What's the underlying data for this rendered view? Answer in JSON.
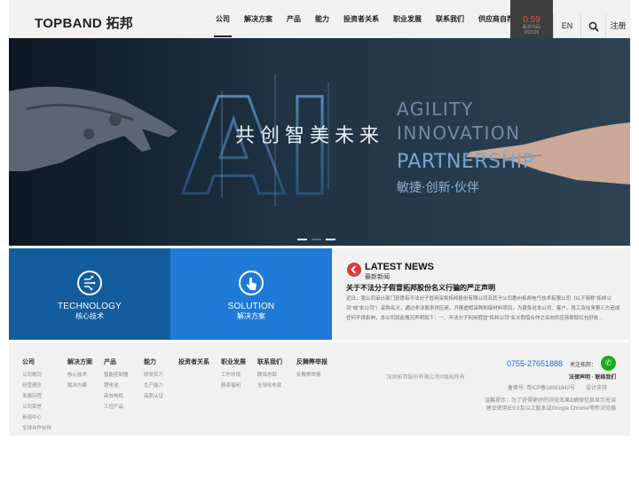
{
  "header": {
    "logo": "TOPBAND 拓邦",
    "nav": [
      "公司",
      "解决方案",
      "产品",
      "能力",
      "投资者关系",
      "职业发展",
      "联系我们",
      "供应商自荐"
    ],
    "stock_value": "0.59",
    "stock_label_1": "股票代码",
    "stock_label_2": "002139",
    "lang_label": "EN",
    "register_label": "注册"
  },
  "banner": {
    "cn_slogan": "共创智美未来",
    "en_line_1": "AGILITY",
    "en_line_2": "INNOVATION",
    "en_line_3": "PARTNERSHIP",
    "cn_tagline": "敏捷·创新·伙伴",
    "big_letters": "AI"
  },
  "tiles": [
    {
      "en": "TECHNOLOGY",
      "cn": "核心技术"
    },
    {
      "en": "SOLUTION",
      "cn": "解决方案"
    }
  ],
  "news": {
    "title": "LATEST NEWS",
    "subtitle": "最新新闻",
    "headline": "关于不法分子假冒拓邦股份名义行骗的严正声明",
    "body": "近日，我公司审计部门获悉有不法分子冒用深圳拓邦股份有限公司及其子公司惠州拓邦电气技术有限公司（以下简称\"拓邦公司\"或\"本公司\"）采购名义，通过非法联系供应商，开展虚假采购和接材料项目，为避免对本公司、客户、员工及往来第三方造成任何不良影响，本公司就此情况声明如下：一、不法分子利用假冒\"拓邦公司\"名义假借合作之名向供应商索取红包好处..."
  },
  "footer": {
    "columns": [
      {
        "head": "公司",
        "items": [
          "公司概况",
          "经营理念",
          "发展历程",
          "公司荣誉",
          "新闻中心",
          "全球合作伙伴"
        ]
      },
      {
        "head": "解决方案",
        "items": [
          "核心技术",
          "解决方案"
        ]
      },
      {
        "head": "产品",
        "items": [
          "智能控制器",
          "锂电池",
          "高效电机",
          "工控产品"
        ]
      },
      {
        "head": "能力",
        "items": [
          "研发实力",
          "生产能力",
          "品质认证"
        ]
      },
      {
        "head": "投资者关系",
        "items": []
      },
      {
        "head": "职业发展",
        "items": [
          "工作环境",
          "薪资福利"
        ]
      },
      {
        "head": "联系我们",
        "items": [
          "联络总部",
          "全球化布局"
        ]
      },
      {
        "head": "反舞弊举报",
        "items": [
          "反舞弊举报"
        ]
      }
    ],
    "phone": "0755-27651888",
    "follow_label": "关注拓邦：",
    "legal": "法律声明 · 联络我们",
    "copyright": "深圳拓邦股份有限公司©版权所有",
    "icp": "备案号: 粤ICP备18081842号",
    "design": "设计支持",
    "hint_1": "温馨提示：为了获得更好的浏览效果&确保信息显示无误",
    "hint_2": "建议使用IE9.0及以上版本或Google Chrome等新浏览器"
  },
  "colors": {
    "tile_tech": "#135c9e",
    "tile_solution": "#1f7ad8",
    "news_icon": "#d83a3a",
    "phone": "#1f6fc9",
    "wechat": "#1aac19"
  }
}
